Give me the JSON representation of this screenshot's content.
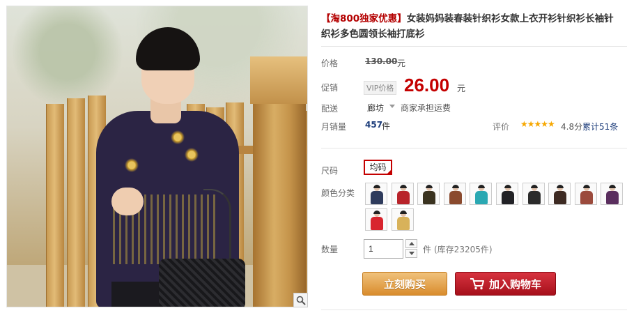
{
  "product": {
    "title_promo": "【淘800独家优惠】",
    "title_main": "女装妈妈装春装针织衫女款上衣开衫针织衫长袖针织衫多色圆领长袖打底衫"
  },
  "price": {
    "label": "价格",
    "original": "130.00",
    "currency": "元"
  },
  "promo": {
    "label": "促销",
    "badge": "VIP价格",
    "price": "26.00",
    "currency": "元"
  },
  "shipping": {
    "label": "配送",
    "from": "廊坊",
    "note": "商家承担运费"
  },
  "sales": {
    "label": "月销量",
    "count": "457",
    "unit": "件"
  },
  "reviews": {
    "label": "评价",
    "stars": "★★★★★",
    "score": "4.8分",
    "count": "累计51条"
  },
  "size": {
    "label": "尺码",
    "selected": "均码"
  },
  "color": {
    "label": "颜色分类",
    "swatches": [
      {
        "name": "swatch-navy",
        "color": "#2e3b5c"
      },
      {
        "name": "swatch-red",
        "color": "#b8232a"
      },
      {
        "name": "swatch-black-gold",
        "color": "#3a3320"
      },
      {
        "name": "swatch-brown",
        "color": "#8a4a2e"
      },
      {
        "name": "swatch-teal",
        "color": "#2aa8b2"
      },
      {
        "name": "swatch-black",
        "color": "#222226"
      },
      {
        "name": "swatch-black-2",
        "color": "#2b2b2b"
      },
      {
        "name": "swatch-dark-brown",
        "color": "#3d2a22"
      },
      {
        "name": "swatch-rust",
        "color": "#9b4a3c"
      },
      {
        "name": "swatch-purple",
        "color": "#5a2e5e"
      },
      {
        "name": "swatch-bright-red",
        "color": "#d8242e"
      },
      {
        "name": "swatch-gold",
        "color": "#d8b25a"
      }
    ]
  },
  "quantity": {
    "label": "数量",
    "value": "1",
    "unit": "件",
    "stock": "(库存23205件)"
  },
  "actions": {
    "buy_now": "立刻购买",
    "add_to_cart": "加入购物车"
  },
  "colors": {
    "accent": "#c40000",
    "link": "#1d3d7b"
  }
}
